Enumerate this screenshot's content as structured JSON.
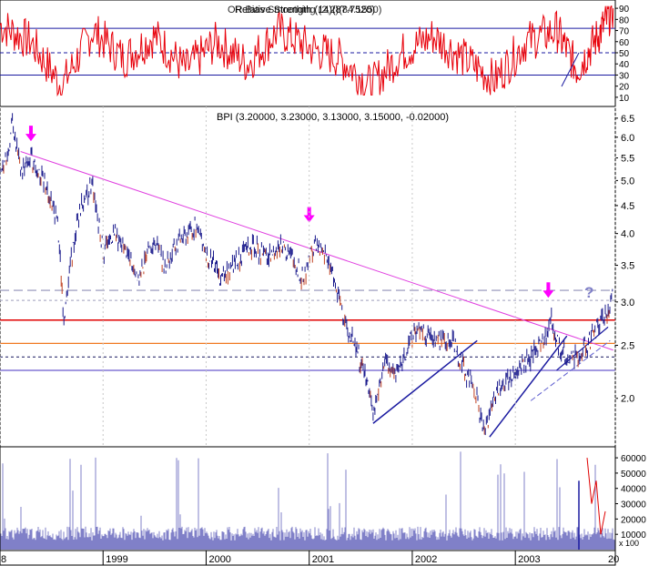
{
  "rsi_panel": {
    "title_overlap_1": "Relative Strength (14)(87.7520)",
    "title_overlap_2": "OR Bias Smoothing (2,2)(84.1550)",
    "yticks": [
      10,
      20,
      30,
      40,
      50,
      60,
      70,
      80,
      90
    ],
    "ylim": [
      5,
      95
    ],
    "hlines": [
      {
        "value": 72,
        "color": "#1a1aa0",
        "style": "solid"
      },
      {
        "value": 50,
        "color": "#1a1aa0",
        "style": "dashed"
      },
      {
        "value": 30,
        "color": "#1a1aa0",
        "style": "solid"
      }
    ],
    "line_color": "#e8000a",
    "last_value": 90
  },
  "price_panel": {
    "title": "BPI (3.20000, 3.23000, 3.13000, 3.15000, -0.02000)",
    "yticks": [
      "6.5",
      "6.0",
      "5.5",
      "5.0",
      "4.5",
      "4.0",
      "3.5",
      "3.0",
      "2.5",
      "2.0"
    ],
    "yscale": "log",
    "ylim": [
      1.65,
      6.75
    ],
    "hlines": [
      {
        "value": 3.15,
        "color": "#9090b8",
        "style": "dashed"
      },
      {
        "value": 3.02,
        "color": "#b0b0c8",
        "style": "dotted"
      },
      {
        "value": 2.78,
        "color": "#e00000",
        "style": "solid"
      },
      {
        "value": 2.52,
        "color": "#f07820",
        "style": "solid"
      },
      {
        "value": 2.38,
        "color": "#303070",
        "style": "dotted"
      },
      {
        "value": 2.25,
        "color": "#6a5acd",
        "style": "solid"
      }
    ],
    "bar_color": "#1a1a8c",
    "down_bar_color": "#c04020",
    "annotation_question": "?",
    "annotation_color": "#8080c8",
    "arrow_color": "#ff00ff",
    "trendline_color": "#e040e0",
    "support_color": "#1a1aa0"
  },
  "volume_panel": {
    "yticks": [
      "60000",
      "50000",
      "40000",
      "30000",
      "20000",
      "10000"
    ],
    "unit_label": "x 100",
    "ylim": [
      0,
      66000
    ],
    "fill_color": "#8080c8"
  },
  "x_axis": {
    "labels": [
      "8",
      "1999",
      "2000",
      "2001",
      "2002",
      "2003",
      "20"
    ]
  },
  "chart_data": {
    "type": "line",
    "title": "BPI (3.20000, 3.23000, 3.13000, 3.15000, -0.02000)",
    "last_bar": {
      "open": 3.2,
      "high": 3.23,
      "low": 3.13,
      "close": 3.15,
      "change": -0.02
    },
    "x": [
      1998.0,
      1998.08,
      1998.12,
      1998.2,
      1998.3,
      1998.45,
      1998.55,
      1998.62,
      1998.7,
      1998.8,
      1998.9,
      1999.0,
      1999.1,
      1999.2,
      1999.35,
      1999.5,
      1999.6,
      1999.75,
      1999.9,
      2000.0,
      2000.15,
      2000.3,
      2000.45,
      2000.6,
      2000.75,
      2000.95,
      2001.05,
      2001.2,
      2001.3,
      2001.4,
      2001.55,
      2001.62,
      2001.75,
      2001.85,
      2002.0,
      2002.1,
      2002.25,
      2002.4,
      2002.5,
      2002.6,
      2002.7,
      2002.8,
      2002.9,
      2003.05,
      2003.2,
      2003.3,
      2003.35,
      2003.4,
      2003.5,
      2003.6,
      2003.7,
      2003.8,
      2003.9,
      2003.95
    ],
    "y": [
      5.0,
      5.6,
      6.4,
      5.2,
      5.5,
      4.9,
      4.3,
      2.8,
      3.7,
      4.6,
      4.9,
      3.7,
      4.0,
      3.8,
      3.3,
      3.9,
      3.5,
      3.9,
      4.1,
      3.7,
      3.3,
      3.6,
      3.8,
      3.6,
      3.8,
      3.3,
      3.85,
      3.5,
      3.0,
      2.6,
      2.2,
      1.85,
      2.35,
      2.2,
      2.6,
      2.65,
      2.55,
      2.55,
      2.25,
      2.1,
      1.7,
      2.05,
      2.15,
      2.25,
      2.45,
      2.6,
      2.8,
      2.55,
      2.35,
      2.4,
      2.5,
      2.7,
      2.85,
      3.2
    ],
    "series": [
      {
        "name": "Relative Strength (14)",
        "x": [
          1998.0,
          1998.3,
          1998.6,
          1998.9,
          1999.2,
          1999.5,
          1999.8,
          2000.1,
          2000.4,
          2000.7,
          2001.0,
          2001.3,
          2001.6,
          2001.9,
          2002.2,
          2002.5,
          2002.8,
          2003.1,
          2003.4,
          2003.6,
          2003.8,
          2003.95
        ],
        "values": [
          75,
          60,
          20,
          70,
          45,
          65,
          35,
          60,
          40,
          70,
          55,
          45,
          20,
          50,
          65,
          45,
          25,
          60,
          70,
          35,
          65,
          90
        ]
      },
      {
        "name": "Volume",
        "x": [
          1998.0,
          1998.5,
          1999.0,
          1999.5,
          2000.0,
          2000.5,
          2001.0,
          2001.5,
          2002.0,
          2002.5,
          2003.0,
          2003.5,
          2003.9
        ],
        "values": [
          12000,
          35000,
          15000,
          18000,
          12000,
          14000,
          16000,
          20000,
          18000,
          22000,
          15000,
          20000,
          60000
        ]
      }
    ],
    "xlabel": "",
    "ylabel": "",
    "ylim": [
      1.65,
      6.75
    ]
  }
}
